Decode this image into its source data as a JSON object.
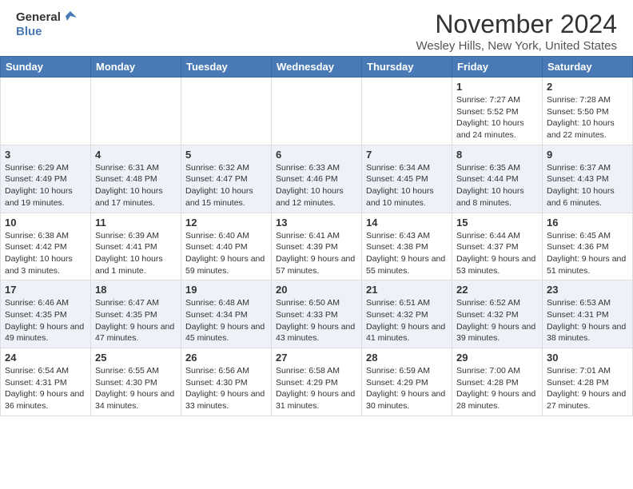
{
  "header": {
    "logo_line1": "General",
    "logo_line2": "Blue",
    "month": "November 2024",
    "location": "Wesley Hills, New York, United States"
  },
  "days_of_week": [
    "Sunday",
    "Monday",
    "Tuesday",
    "Wednesday",
    "Thursday",
    "Friday",
    "Saturday"
  ],
  "weeks": [
    [
      {
        "day": "",
        "info": ""
      },
      {
        "day": "",
        "info": ""
      },
      {
        "day": "",
        "info": ""
      },
      {
        "day": "",
        "info": ""
      },
      {
        "day": "",
        "info": ""
      },
      {
        "day": "1",
        "info": "Sunrise: 7:27 AM\nSunset: 5:52 PM\nDaylight: 10 hours and 24 minutes."
      },
      {
        "day": "2",
        "info": "Sunrise: 7:28 AM\nSunset: 5:50 PM\nDaylight: 10 hours and 22 minutes."
      }
    ],
    [
      {
        "day": "3",
        "info": "Sunrise: 6:29 AM\nSunset: 4:49 PM\nDaylight: 10 hours and 19 minutes."
      },
      {
        "day": "4",
        "info": "Sunrise: 6:31 AM\nSunset: 4:48 PM\nDaylight: 10 hours and 17 minutes."
      },
      {
        "day": "5",
        "info": "Sunrise: 6:32 AM\nSunset: 4:47 PM\nDaylight: 10 hours and 15 minutes."
      },
      {
        "day": "6",
        "info": "Sunrise: 6:33 AM\nSunset: 4:46 PM\nDaylight: 10 hours and 12 minutes."
      },
      {
        "day": "7",
        "info": "Sunrise: 6:34 AM\nSunset: 4:45 PM\nDaylight: 10 hours and 10 minutes."
      },
      {
        "day": "8",
        "info": "Sunrise: 6:35 AM\nSunset: 4:44 PM\nDaylight: 10 hours and 8 minutes."
      },
      {
        "day": "9",
        "info": "Sunrise: 6:37 AM\nSunset: 4:43 PM\nDaylight: 10 hours and 6 minutes."
      }
    ],
    [
      {
        "day": "10",
        "info": "Sunrise: 6:38 AM\nSunset: 4:42 PM\nDaylight: 10 hours and 3 minutes."
      },
      {
        "day": "11",
        "info": "Sunrise: 6:39 AM\nSunset: 4:41 PM\nDaylight: 10 hours and 1 minute."
      },
      {
        "day": "12",
        "info": "Sunrise: 6:40 AM\nSunset: 4:40 PM\nDaylight: 9 hours and 59 minutes."
      },
      {
        "day": "13",
        "info": "Sunrise: 6:41 AM\nSunset: 4:39 PM\nDaylight: 9 hours and 57 minutes."
      },
      {
        "day": "14",
        "info": "Sunrise: 6:43 AM\nSunset: 4:38 PM\nDaylight: 9 hours and 55 minutes."
      },
      {
        "day": "15",
        "info": "Sunrise: 6:44 AM\nSunset: 4:37 PM\nDaylight: 9 hours and 53 minutes."
      },
      {
        "day": "16",
        "info": "Sunrise: 6:45 AM\nSunset: 4:36 PM\nDaylight: 9 hours and 51 minutes."
      }
    ],
    [
      {
        "day": "17",
        "info": "Sunrise: 6:46 AM\nSunset: 4:35 PM\nDaylight: 9 hours and 49 minutes."
      },
      {
        "day": "18",
        "info": "Sunrise: 6:47 AM\nSunset: 4:35 PM\nDaylight: 9 hours and 47 minutes."
      },
      {
        "day": "19",
        "info": "Sunrise: 6:48 AM\nSunset: 4:34 PM\nDaylight: 9 hours and 45 minutes."
      },
      {
        "day": "20",
        "info": "Sunrise: 6:50 AM\nSunset: 4:33 PM\nDaylight: 9 hours and 43 minutes."
      },
      {
        "day": "21",
        "info": "Sunrise: 6:51 AM\nSunset: 4:32 PM\nDaylight: 9 hours and 41 minutes."
      },
      {
        "day": "22",
        "info": "Sunrise: 6:52 AM\nSunset: 4:32 PM\nDaylight: 9 hours and 39 minutes."
      },
      {
        "day": "23",
        "info": "Sunrise: 6:53 AM\nSunset: 4:31 PM\nDaylight: 9 hours and 38 minutes."
      }
    ],
    [
      {
        "day": "24",
        "info": "Sunrise: 6:54 AM\nSunset: 4:31 PM\nDaylight: 9 hours and 36 minutes."
      },
      {
        "day": "25",
        "info": "Sunrise: 6:55 AM\nSunset: 4:30 PM\nDaylight: 9 hours and 34 minutes."
      },
      {
        "day": "26",
        "info": "Sunrise: 6:56 AM\nSunset: 4:30 PM\nDaylight: 9 hours and 33 minutes."
      },
      {
        "day": "27",
        "info": "Sunrise: 6:58 AM\nSunset: 4:29 PM\nDaylight: 9 hours and 31 minutes."
      },
      {
        "day": "28",
        "info": "Sunrise: 6:59 AM\nSunset: 4:29 PM\nDaylight: 9 hours and 30 minutes."
      },
      {
        "day": "29",
        "info": "Sunrise: 7:00 AM\nSunset: 4:28 PM\nDaylight: 9 hours and 28 minutes."
      },
      {
        "day": "30",
        "info": "Sunrise: 7:01 AM\nSunset: 4:28 PM\nDaylight: 9 hours and 27 minutes."
      }
    ]
  ]
}
